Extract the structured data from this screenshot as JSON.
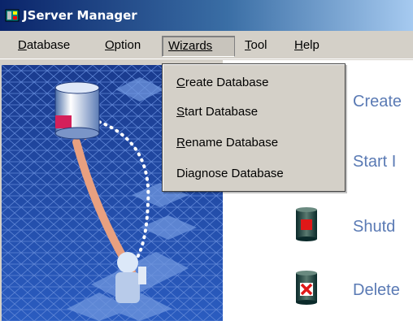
{
  "window": {
    "title": "JServer Manager"
  },
  "menubar": {
    "items": [
      {
        "label_pre": "",
        "label_u": "D",
        "label_post": "atabase"
      },
      {
        "label_pre": "",
        "label_u": "O",
        "label_post": "ption"
      },
      {
        "label_pre": "",
        "label_u": "W",
        "label_post": "izards"
      },
      {
        "label_pre": "",
        "label_u": "T",
        "label_post": "ool"
      },
      {
        "label_pre": "",
        "label_u": "H",
        "label_post": "elp"
      }
    ]
  },
  "wizards_menu": {
    "items": [
      {
        "pre": "",
        "u": "C",
        "post": "reate Database"
      },
      {
        "pre": "",
        "u": "S",
        "post": "tart Database"
      },
      {
        "pre": "",
        "u": "R",
        "post": "ename Database"
      },
      {
        "pre": "Dia",
        "u": "g",
        "post": "nose Database"
      }
    ]
  },
  "actions": {
    "create": "Create",
    "start": "Start I",
    "shutdown": "Shutd",
    "delete": "Delete"
  },
  "colors": {
    "title_gradient_start": "#0a246a",
    "menu_bg": "#d4d0c8",
    "action_text": "#5a7ab4",
    "panel_blue": "#1e3f9a"
  }
}
